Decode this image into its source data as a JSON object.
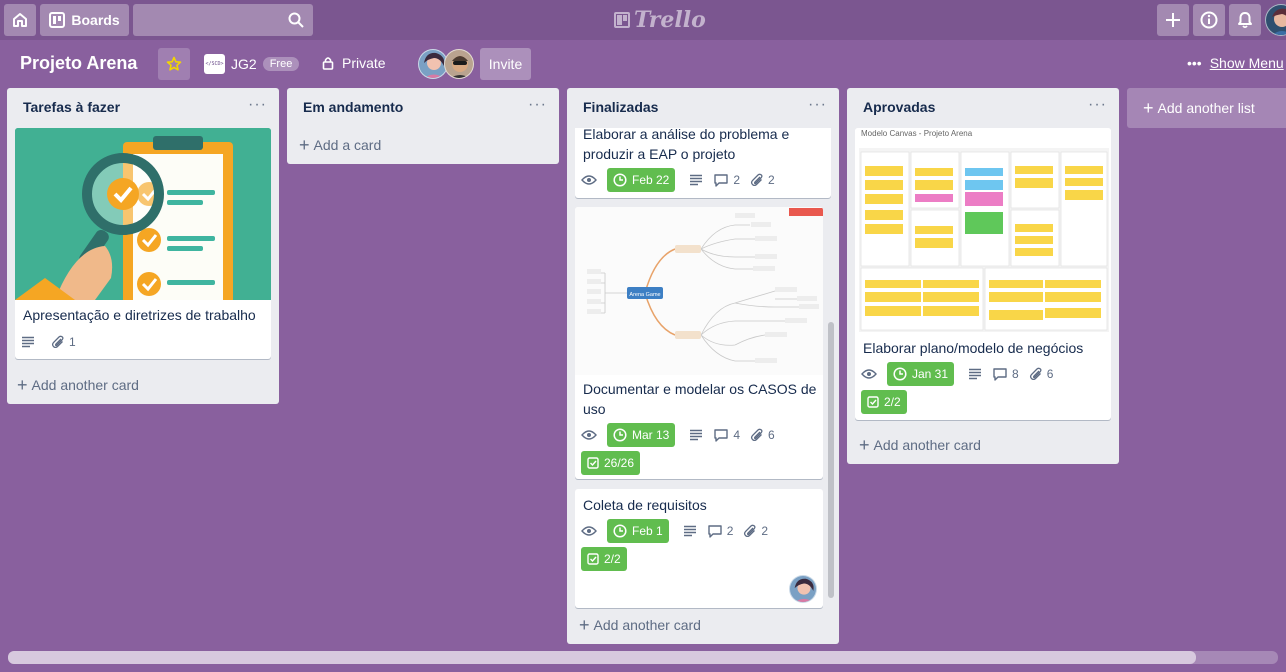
{
  "topbar": {
    "boards_label": "Boards",
    "logo_text": "Trello"
  },
  "board": {
    "title": "Projeto Arena",
    "team_logo_text": "</SCD>",
    "team_name": "JG2",
    "plan_badge": "Free",
    "visibility": "Private",
    "invite_label": "Invite",
    "show_menu_label": "Show Menu"
  },
  "colors": {
    "background": "#89609e",
    "label_green": "#61bd4f",
    "star": "#f2d600"
  },
  "lists": [
    {
      "title": "Tarefas à fazer",
      "add_label": "Add another card",
      "cards": [
        {
          "title": "Apresentação e diretrizes de trabalho",
          "attachments": "1",
          "cover": "checklist-magnifier-illustration"
        }
      ]
    },
    {
      "title": "Em andamento",
      "add_label": "Add a card",
      "cards": []
    },
    {
      "title": "Finalizadas",
      "add_label": "Add another card",
      "cards": [
        {
          "title": "Elaborar a análise do problema e produzir a EAP o projeto",
          "due": "Feb 22",
          "comments": "2",
          "attachments": "2"
        },
        {
          "title": "Documentar e modelar os CASOS de uso",
          "due": "Mar 13",
          "comments": "4",
          "attachments": "6",
          "checklist": "26/26",
          "cover": "mind-map-diagram",
          "cover_label": "Arena Game"
        },
        {
          "title": "Coleta de requisitos",
          "due": "Feb 1",
          "comments": "2",
          "attachments": "2",
          "checklist": "2/2"
        }
      ]
    },
    {
      "title": "Aprovadas",
      "add_label": "Add another card",
      "cards": [
        {
          "title": "Elaborar plano/modelo de negócios",
          "due": "Jan 31",
          "comments": "8",
          "attachments": "6",
          "checklist": "2/2",
          "cover": "business-model-canvas",
          "cover_label": "Modelo Canvas - Projeto Arena"
        }
      ]
    }
  ],
  "add_list_label": "Add another list"
}
